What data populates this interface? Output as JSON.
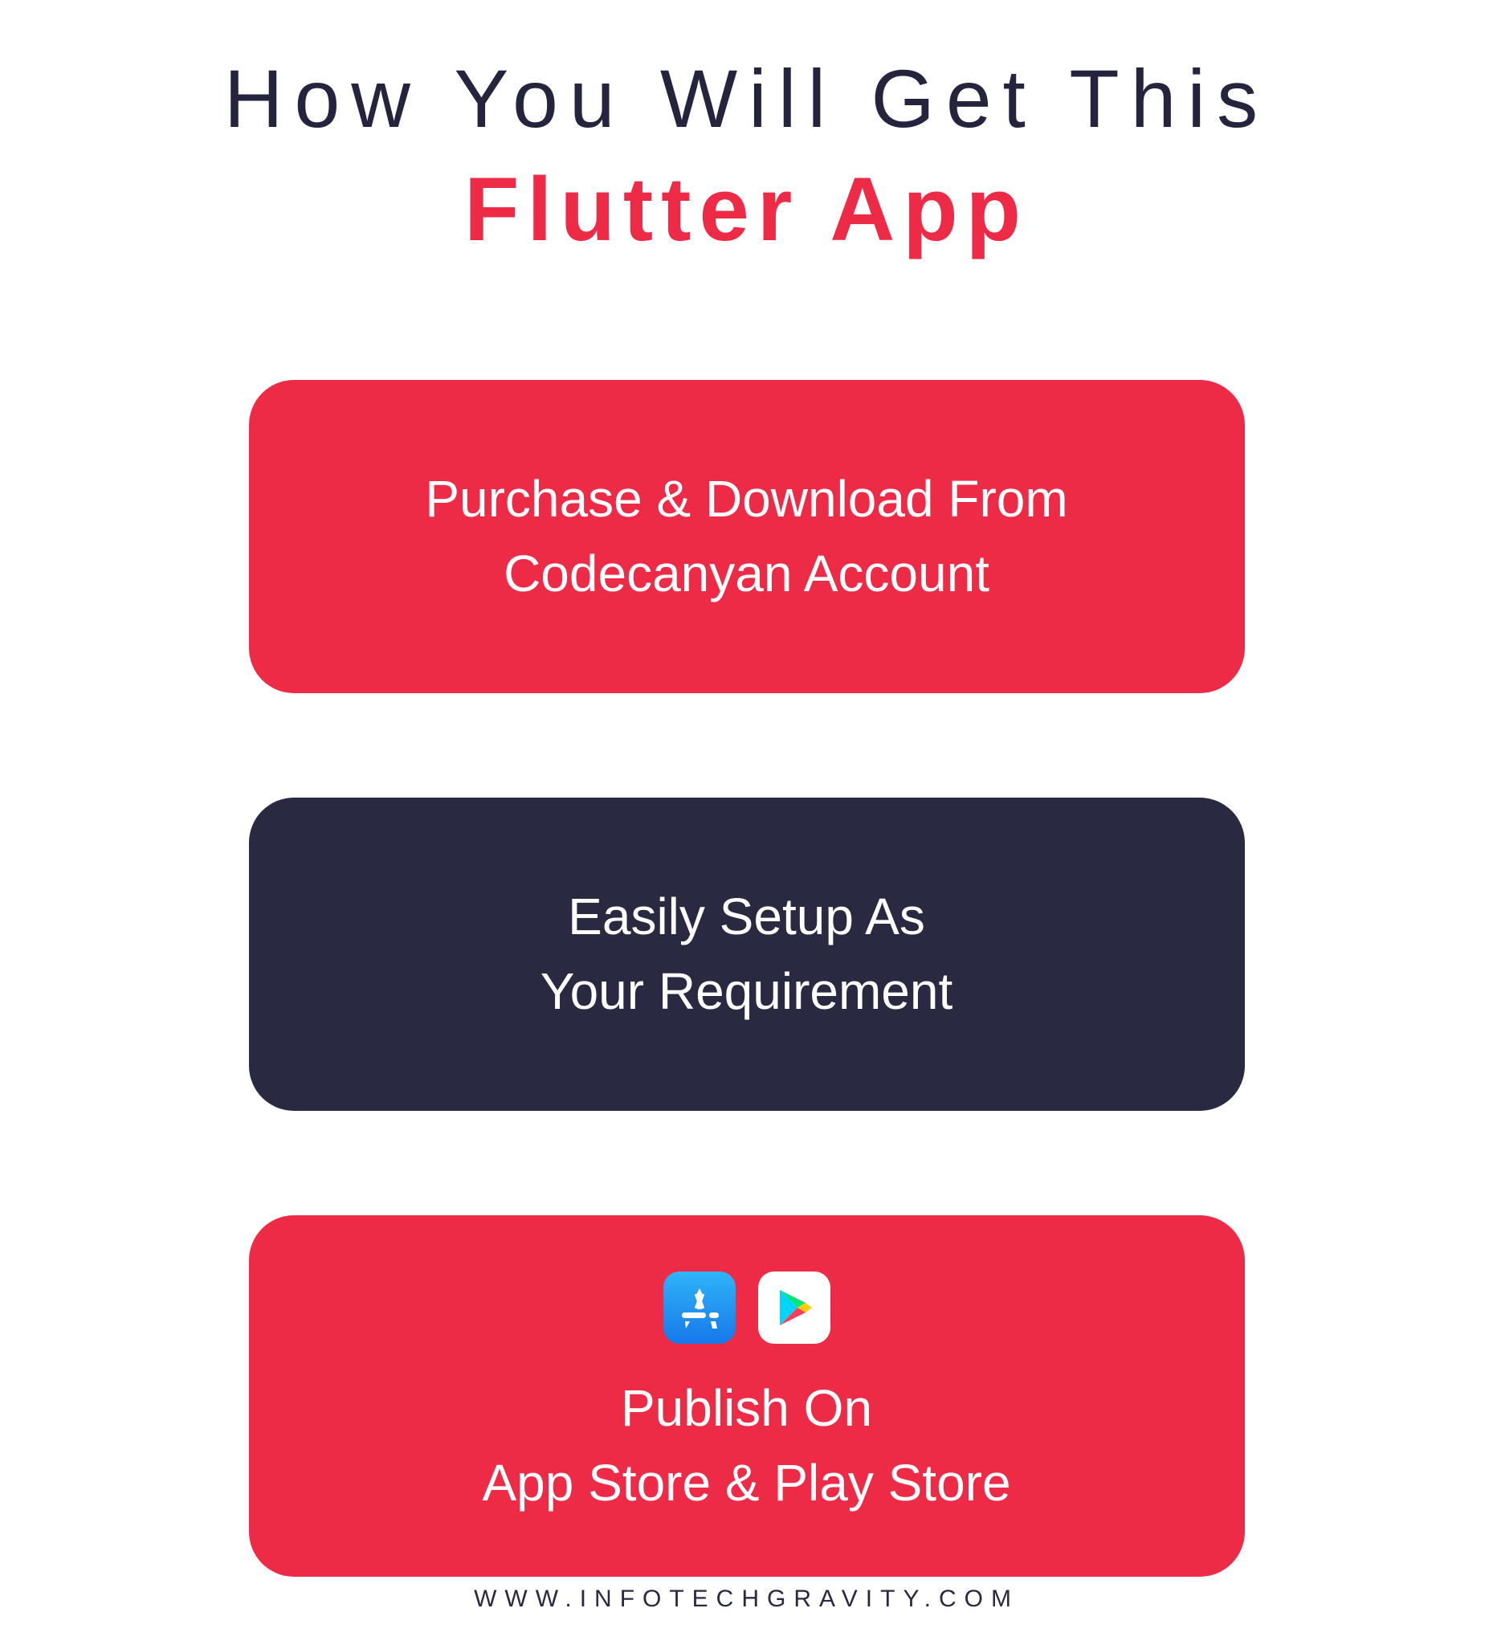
{
  "heading": {
    "line1": "How You Will Get This",
    "line2": "Flutter App"
  },
  "cards": [
    {
      "line1": "Purchase & Download From",
      "line2": "Codecanyan Account"
    },
    {
      "line1": "Easily Setup As",
      "line2": "Your Requirement"
    },
    {
      "line1": "Publish On",
      "line2": "App Store & Play Store"
    }
  ],
  "icons": {
    "appstore": "app-store-icon",
    "playstore": "play-store-icon"
  },
  "footer": "WWW.INFOTECHGRAVITY.COM",
  "colors": {
    "accent_red": "#ee2b47",
    "dark_navy": "#2a2942",
    "heading_dark": "#25243e"
  }
}
